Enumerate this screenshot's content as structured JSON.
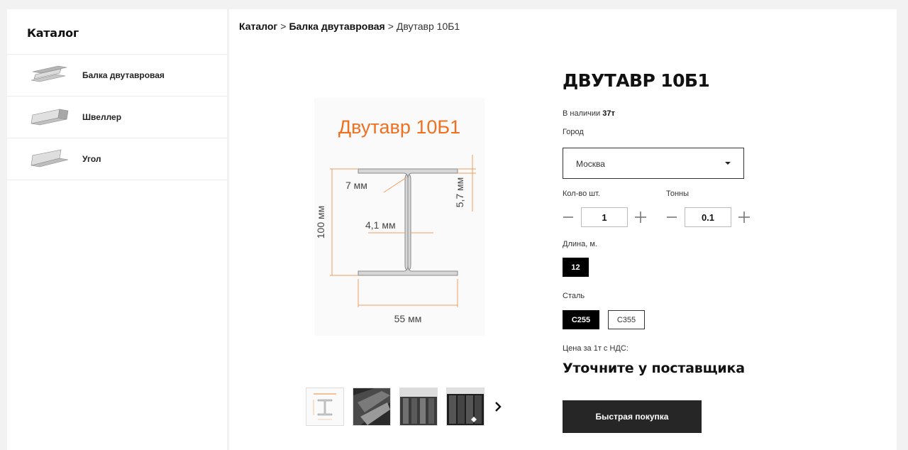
{
  "sidebar": {
    "title": "Каталог",
    "items": [
      {
        "label": "Балка двутавровая",
        "icon": "i-beam-icon"
      },
      {
        "label": "Швеллер",
        "icon": "channel-icon"
      },
      {
        "label": "Угол",
        "icon": "angle-icon"
      }
    ]
  },
  "breadcrumb": {
    "items": [
      "Каталог",
      "Балка двутавровая"
    ],
    "current": "Двутавр 10Б1",
    "separator": ">"
  },
  "product_image": {
    "title": "Двутавр 10Б1",
    "dim_flange": "7 мм",
    "dim_web": "4,1 мм",
    "dim_height": "100 мм",
    "dim_flange_thickness": "5,7 мм",
    "dim_width": "55 мм",
    "title_color": "#f07020",
    "dimension_color": "#f0a060"
  },
  "product": {
    "title": "ДВУТАВР 10Б1",
    "stock_label": "В наличии",
    "stock_value": "37т",
    "city_label": "Город",
    "city_value": "Москва",
    "qty_label": "Кол-во шт.",
    "qty_value": "1",
    "tons_label": "Тонны",
    "tons_value": "0.1",
    "length_label": "Длина, м.",
    "length_options": [
      "12"
    ],
    "steel_label": "Сталь",
    "steel_options": [
      "С255",
      "С355"
    ],
    "price_label": "Цена за 1т с НДС:",
    "price_value": "Уточните у поставщика",
    "buy_label": "Быстрая покупка"
  }
}
